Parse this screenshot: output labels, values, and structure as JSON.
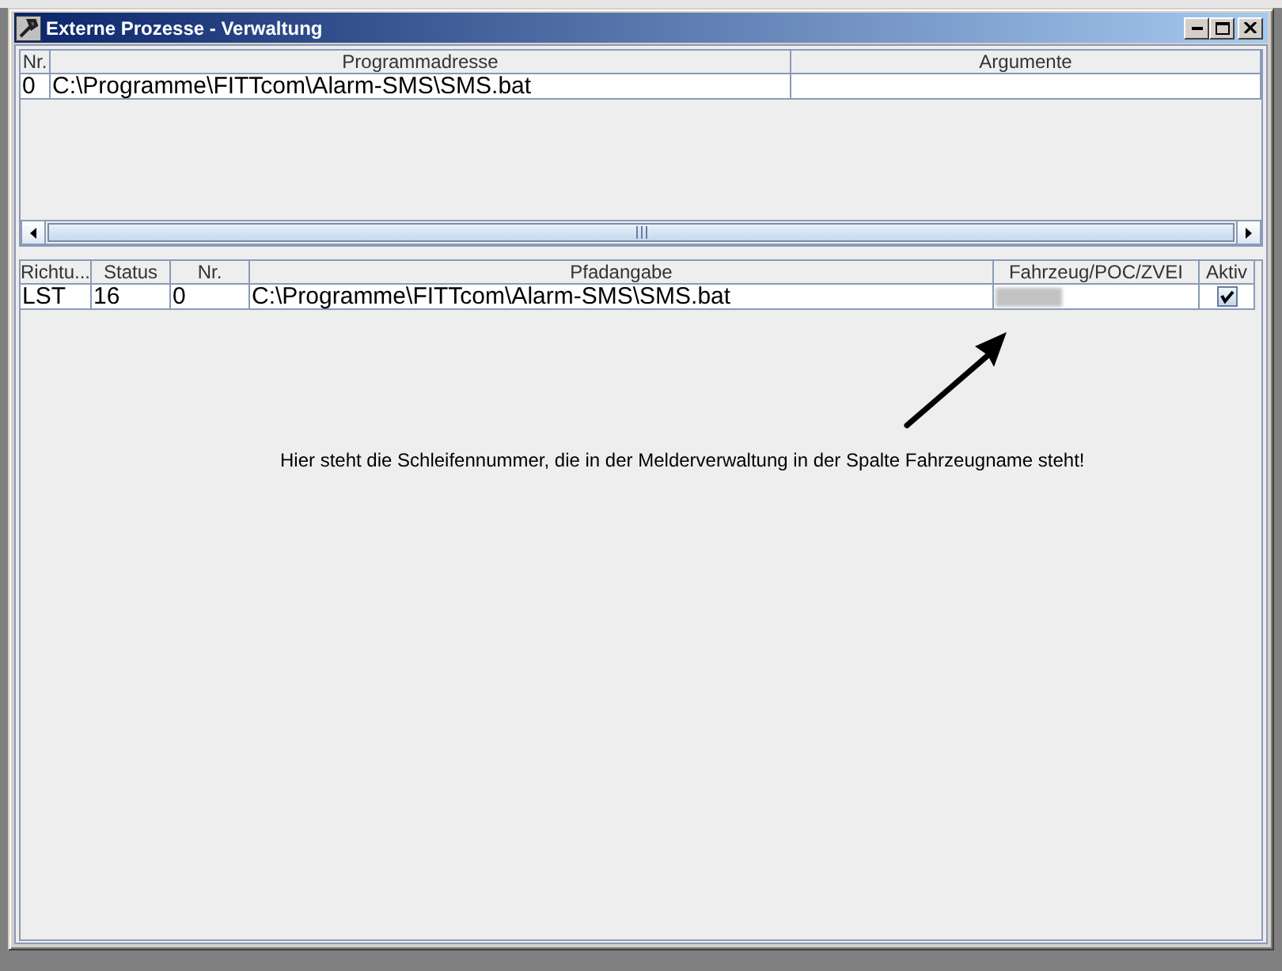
{
  "window": {
    "title": "Externe Prozesse - Verwaltung"
  },
  "process_table": {
    "columns": [
      "Nr.",
      "Programmadresse",
      "Argumente"
    ],
    "rows": [
      {
        "cells": [
          "0",
          "C:\\Programme\\FITTcom\\Alarm-SMS\\SMS.bat"
        ]
      }
    ]
  },
  "assignment_table": {
    "columns": [
      "Richtu...",
      "Status",
      "Nr.",
      "Pfadangabe",
      "Fahrzeug/POC/ZVEI",
      "Aktiv"
    ],
    "rows": [
      {
        "cells": [
          "LST",
          "16",
          "0",
          "C:\\Programme\\FITTcom\\Alarm-SMS\\SMS.bat"
        ],
        "vehicle_blurred": true,
        "active": true
      }
    ]
  },
  "annotation": {
    "text": "Hier steht die Schleifennummer, die in der Melderverwaltung in der Spalte Fahrzeugname steht!"
  }
}
